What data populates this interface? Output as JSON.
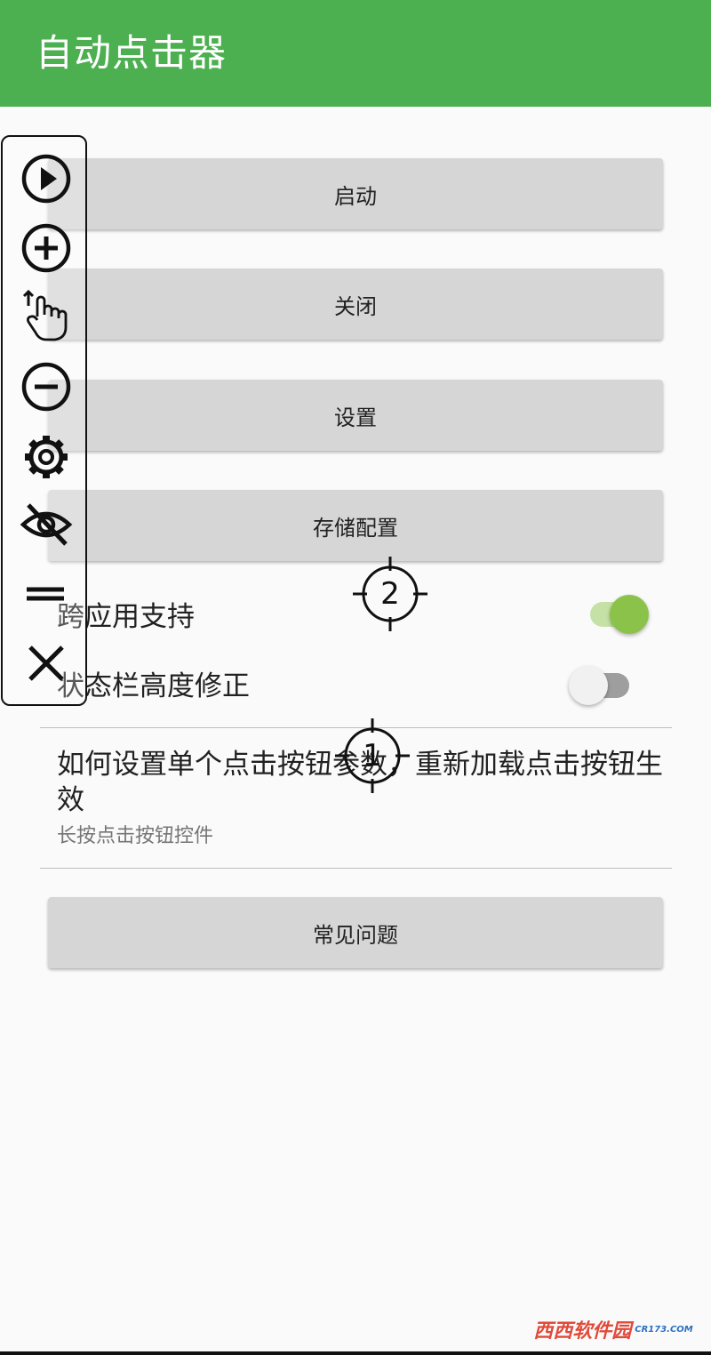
{
  "app_bar": {
    "title": "自动点击器"
  },
  "buttons": {
    "start": "启动",
    "close": "关闭",
    "settings": "设置",
    "storage_config": "存储配置",
    "faq": "常见问题"
  },
  "settings_rows": [
    {
      "label": "跨应用支持",
      "enabled": true
    },
    {
      "label": "状态栏高度修正",
      "enabled": false
    }
  ],
  "help": {
    "title": "如何设置单个点击按钮参数，重新加载点击按钮生效",
    "subtitle": "长按点击按钮控件"
  },
  "floating_toolbar": {
    "icons": [
      "play-icon",
      "add-icon",
      "swipe-gesture-icon",
      "remove-icon",
      "gear-icon",
      "hide-eye-icon",
      "drag-handle-icon",
      "close-icon"
    ]
  },
  "click_targets": [
    {
      "label": "2"
    },
    {
      "label": "1"
    }
  ],
  "colors": {
    "app_bar": "#4caf50",
    "switch_on_thumb": "#8bc34a",
    "switch_on_track": "#c5e1a5",
    "switch_off_thumb": "#f1f1f1",
    "switch_off_track": "#9e9e9e",
    "button_bg": "#d6d6d6"
  },
  "watermark": {
    "text": "西西软件园",
    "subtext": "CR173.COM"
  }
}
